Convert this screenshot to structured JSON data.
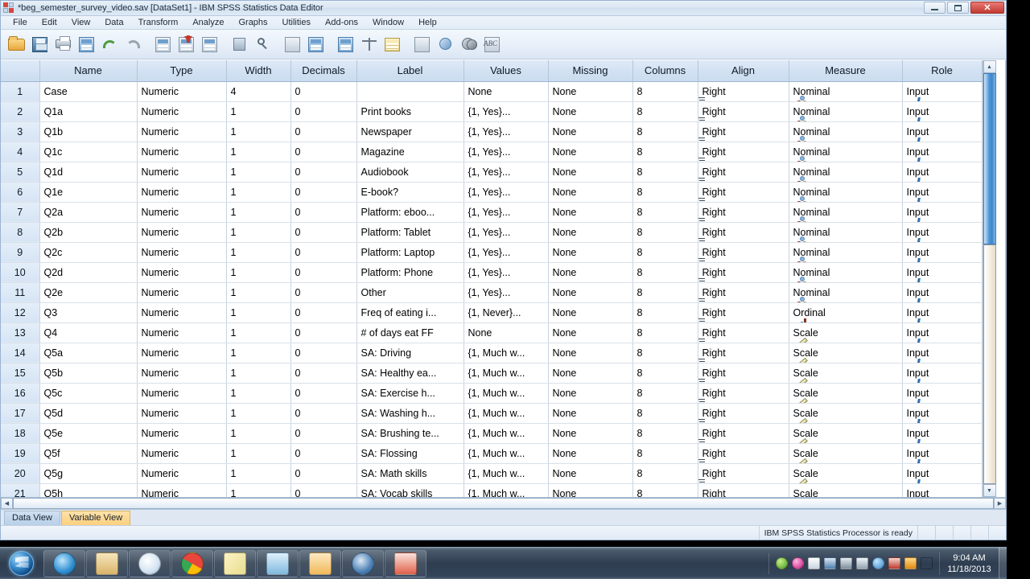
{
  "window": {
    "title": "*beg_semester_survey_video.sav [DataSet1] - IBM SPSS Statistics Data Editor",
    "app_icon": "spss-logo-icon",
    "controls": {
      "minimize": "minimize-button",
      "maximize": "maximize-button",
      "close": "✕"
    }
  },
  "menu": {
    "items": [
      {
        "label": "File"
      },
      {
        "label": "Edit"
      },
      {
        "label": "View"
      },
      {
        "label": "Data"
      },
      {
        "label": "Transform"
      },
      {
        "label": "Analyze"
      },
      {
        "label": "Graphs"
      },
      {
        "label": "Utilities"
      },
      {
        "label": "Add-ons"
      },
      {
        "label": "Window"
      },
      {
        "label": "Help"
      }
    ]
  },
  "toolbar": {
    "buttons": [
      {
        "name": "open-file-icon"
      },
      {
        "name": "save-icon"
      },
      {
        "name": "print-icon"
      },
      {
        "name": "recall-dialogs-icon"
      },
      {
        "name": "undo-icon"
      },
      {
        "name": "redo-icon"
      },
      {
        "name": "goto-case-icon"
      },
      {
        "name": "goto-variable-icon"
      },
      {
        "name": "variables-icon"
      },
      {
        "name": "run-descriptives-icon"
      },
      {
        "name": "find-icon"
      },
      {
        "name": "insert-case-icon"
      },
      {
        "name": "insert-variable-icon"
      },
      {
        "name": "split-file-icon"
      },
      {
        "name": "weight-cases-icon"
      },
      {
        "name": "select-cases-icon"
      },
      {
        "name": "value-labels-icon"
      },
      {
        "name": "use-variable-sets-icon"
      },
      {
        "name": "show-all-variables-icon"
      },
      {
        "name": "spell-check-icon"
      }
    ]
  },
  "grid": {
    "columns": [
      {
        "key": "name",
        "label": "Name",
        "css": "c-name"
      },
      {
        "key": "type",
        "label": "Type",
        "css": "c-type"
      },
      {
        "key": "width",
        "label": "Width",
        "css": "c-width"
      },
      {
        "key": "decimals",
        "label": "Decimals",
        "css": "c-decimals"
      },
      {
        "key": "label",
        "label": "Label",
        "css": "c-label"
      },
      {
        "key": "values",
        "label": "Values",
        "css": "c-values"
      },
      {
        "key": "missing",
        "label": "Missing",
        "css": "c-missing"
      },
      {
        "key": "columns",
        "label": "Columns",
        "css": "c-columns"
      },
      {
        "key": "align",
        "label": "Align",
        "css": "c-align"
      },
      {
        "key": "measure",
        "label": "Measure",
        "css": "c-measure"
      },
      {
        "key": "role",
        "label": "Role",
        "css": "c-role"
      }
    ],
    "rows": [
      {
        "num": "1",
        "name": "Case",
        "type": "Numeric",
        "width": "4",
        "decimals": "0",
        "label": "",
        "values": "None",
        "missing": "None",
        "columns": "8",
        "align": "Right",
        "measure": "Nominal",
        "measure_icon": "nominal-icon",
        "role": "Input"
      },
      {
        "num": "2",
        "name": "Q1a",
        "type": "Numeric",
        "width": "1",
        "decimals": "0",
        "label": "Print books",
        "values": "{1, Yes}...",
        "missing": "None",
        "columns": "8",
        "align": "Right",
        "measure": "Nominal",
        "measure_icon": "nominal-icon",
        "role": "Input"
      },
      {
        "num": "3",
        "name": "Q1b",
        "type": "Numeric",
        "width": "1",
        "decimals": "0",
        "label": "Newspaper",
        "values": "{1, Yes}...",
        "missing": "None",
        "columns": "8",
        "align": "Right",
        "measure": "Nominal",
        "measure_icon": "nominal-icon",
        "role": "Input"
      },
      {
        "num": "4",
        "name": "Q1c",
        "type": "Numeric",
        "width": "1",
        "decimals": "0",
        "label": "Magazine",
        "values": "{1, Yes}...",
        "missing": "None",
        "columns": "8",
        "align": "Right",
        "measure": "Nominal",
        "measure_icon": "nominal-icon",
        "role": "Input"
      },
      {
        "num": "5",
        "name": "Q1d",
        "type": "Numeric",
        "width": "1",
        "decimals": "0",
        "label": "Audiobook",
        "values": "{1, Yes}...",
        "missing": "None",
        "columns": "8",
        "align": "Right",
        "measure": "Nominal",
        "measure_icon": "nominal-icon",
        "role": "Input"
      },
      {
        "num": "6",
        "name": "Q1e",
        "type": "Numeric",
        "width": "1",
        "decimals": "0",
        "label": "E-book?",
        "values": "{1, Yes}...",
        "missing": "None",
        "columns": "8",
        "align": "Right",
        "measure": "Nominal",
        "measure_icon": "nominal-icon",
        "role": "Input"
      },
      {
        "num": "7",
        "name": "Q2a",
        "type": "Numeric",
        "width": "1",
        "decimals": "0",
        "label": "Platform: eboo...",
        "values": "{1, Yes}...",
        "missing": "None",
        "columns": "8",
        "align": "Right",
        "measure": "Nominal",
        "measure_icon": "nominal-icon",
        "role": "Input"
      },
      {
        "num": "8",
        "name": "Q2b",
        "type": "Numeric",
        "width": "1",
        "decimals": "0",
        "label": "Platform: Tablet",
        "values": "{1, Yes}...",
        "missing": "None",
        "columns": "8",
        "align": "Right",
        "measure": "Nominal",
        "measure_icon": "nominal-icon",
        "role": "Input"
      },
      {
        "num": "9",
        "name": "Q2c",
        "type": "Numeric",
        "width": "1",
        "decimals": "0",
        "label": "Platform: Laptop",
        "values": "{1, Yes}...",
        "missing": "None",
        "columns": "8",
        "align": "Right",
        "measure": "Nominal",
        "measure_icon": "nominal-icon",
        "role": "Input"
      },
      {
        "num": "10",
        "name": "Q2d",
        "type": "Numeric",
        "width": "1",
        "decimals": "0",
        "label": "Platform: Phone",
        "values": "{1, Yes}...",
        "missing": "None",
        "columns": "8",
        "align": "Right",
        "measure": "Nominal",
        "measure_icon": "nominal-icon",
        "role": "Input"
      },
      {
        "num": "11",
        "name": "Q2e",
        "type": "Numeric",
        "width": "1",
        "decimals": "0",
        "label": "Other",
        "values": "{1, Yes}...",
        "missing": "None",
        "columns": "8",
        "align": "Right",
        "measure": "Nominal",
        "measure_icon": "nominal-icon",
        "role": "Input"
      },
      {
        "num": "12",
        "name": "Q3",
        "type": "Numeric",
        "width": "1",
        "decimals": "0",
        "label": "Freq of eating i...",
        "values": "{1, Never}...",
        "missing": "None",
        "columns": "8",
        "align": "Right",
        "measure": "Ordinal",
        "measure_icon": "ordinal-icon",
        "role": "Input"
      },
      {
        "num": "13",
        "name": "Q4",
        "type": "Numeric",
        "width": "1",
        "decimals": "0",
        "label": "# of days eat FF",
        "values": "None",
        "missing": "None",
        "columns": "8",
        "align": "Right",
        "measure": "Scale",
        "measure_icon": "scale-icon",
        "role": "Input"
      },
      {
        "num": "14",
        "name": "Q5a",
        "type": "Numeric",
        "width": "1",
        "decimals": "0",
        "label": "SA: Driving",
        "values": "{1, Much w...",
        "missing": "None",
        "columns": "8",
        "align": "Right",
        "measure": "Scale",
        "measure_icon": "scale-icon",
        "role": "Input"
      },
      {
        "num": "15",
        "name": "Q5b",
        "type": "Numeric",
        "width": "1",
        "decimals": "0",
        "label": "SA:  Healthy ea...",
        "values": "{1, Much w...",
        "missing": "None",
        "columns": "8",
        "align": "Right",
        "measure": "Scale",
        "measure_icon": "scale-icon",
        "role": "Input"
      },
      {
        "num": "16",
        "name": "Q5c",
        "type": "Numeric",
        "width": "1",
        "decimals": "0",
        "label": "SA: Exercise h...",
        "values": "{1, Much w...",
        "missing": "None",
        "columns": "8",
        "align": "Right",
        "measure": "Scale",
        "measure_icon": "scale-icon",
        "role": "Input"
      },
      {
        "num": "17",
        "name": "Q5d",
        "type": "Numeric",
        "width": "1",
        "decimals": "0",
        "label": "SA: Washing h...",
        "values": "{1, Much w...",
        "missing": "None",
        "columns": "8",
        "align": "Right",
        "measure": "Scale",
        "measure_icon": "scale-icon",
        "role": "Input"
      },
      {
        "num": "18",
        "name": "Q5e",
        "type": "Numeric",
        "width": "1",
        "decimals": "0",
        "label": "SA: Brushing te...",
        "values": "{1, Much w...",
        "missing": "None",
        "columns": "8",
        "align": "Right",
        "measure": "Scale",
        "measure_icon": "scale-icon",
        "role": "Input"
      },
      {
        "num": "19",
        "name": "Q5f",
        "type": "Numeric",
        "width": "1",
        "decimals": "0",
        "label": "SA: Flossing",
        "values": "{1, Much w...",
        "missing": "None",
        "columns": "8",
        "align": "Right",
        "measure": "Scale",
        "measure_icon": "scale-icon",
        "role": "Input"
      },
      {
        "num": "20",
        "name": "Q5g",
        "type": "Numeric",
        "width": "1",
        "decimals": "0",
        "label": "SA: Math skills",
        "values": "{1, Much w...",
        "missing": "None",
        "columns": "8",
        "align": "Right",
        "measure": "Scale",
        "measure_icon": "scale-icon",
        "role": "Input"
      },
      {
        "num": "21",
        "name": "Q5h",
        "type": "Numeric",
        "width": "1",
        "decimals": "0",
        "label": "SA: Vocab skills",
        "values": "{1, Much w...",
        "missing": "None",
        "columns": "8",
        "align": "Right",
        "measure": "Scale",
        "measure_icon": "scale-icon",
        "role": "Input"
      }
    ]
  },
  "view_tabs": [
    {
      "label": "Data View",
      "active": false
    },
    {
      "label": "Variable View",
      "active": true
    }
  ],
  "status_bar": {
    "message": "IBM SPSS Statistics Processor is ready"
  },
  "taskbar": {
    "start": "windows-start-orb-icon",
    "items": [
      {
        "name": "internet-explorer-icon"
      },
      {
        "name": "windows-explorer-icon"
      },
      {
        "name": "windows-media-player-icon"
      },
      {
        "name": "google-chrome-icon"
      },
      {
        "name": "sticky-notes-icon"
      },
      {
        "name": "lync-icon"
      },
      {
        "name": "outlook-icon"
      },
      {
        "name": "spss-statistics-icon"
      },
      {
        "name": "powerpoint-icon"
      }
    ],
    "tray": [
      {
        "name": "green-tray-icon"
      },
      {
        "name": "pink-tray-icon"
      },
      {
        "name": "flag-tray-icon"
      },
      {
        "name": "sophos-tray-icon"
      },
      {
        "name": "network-tray-icon"
      },
      {
        "name": "volume-tray-icon"
      },
      {
        "name": "firefox-tray-icon"
      },
      {
        "name": "speaker-mute-tray-icon"
      },
      {
        "name": "orange-shield-tray-icon"
      },
      {
        "name": "yellow-note-tray-icon"
      }
    ],
    "clock": {
      "time": "9:04 AM",
      "date": "11/18/2013"
    }
  }
}
